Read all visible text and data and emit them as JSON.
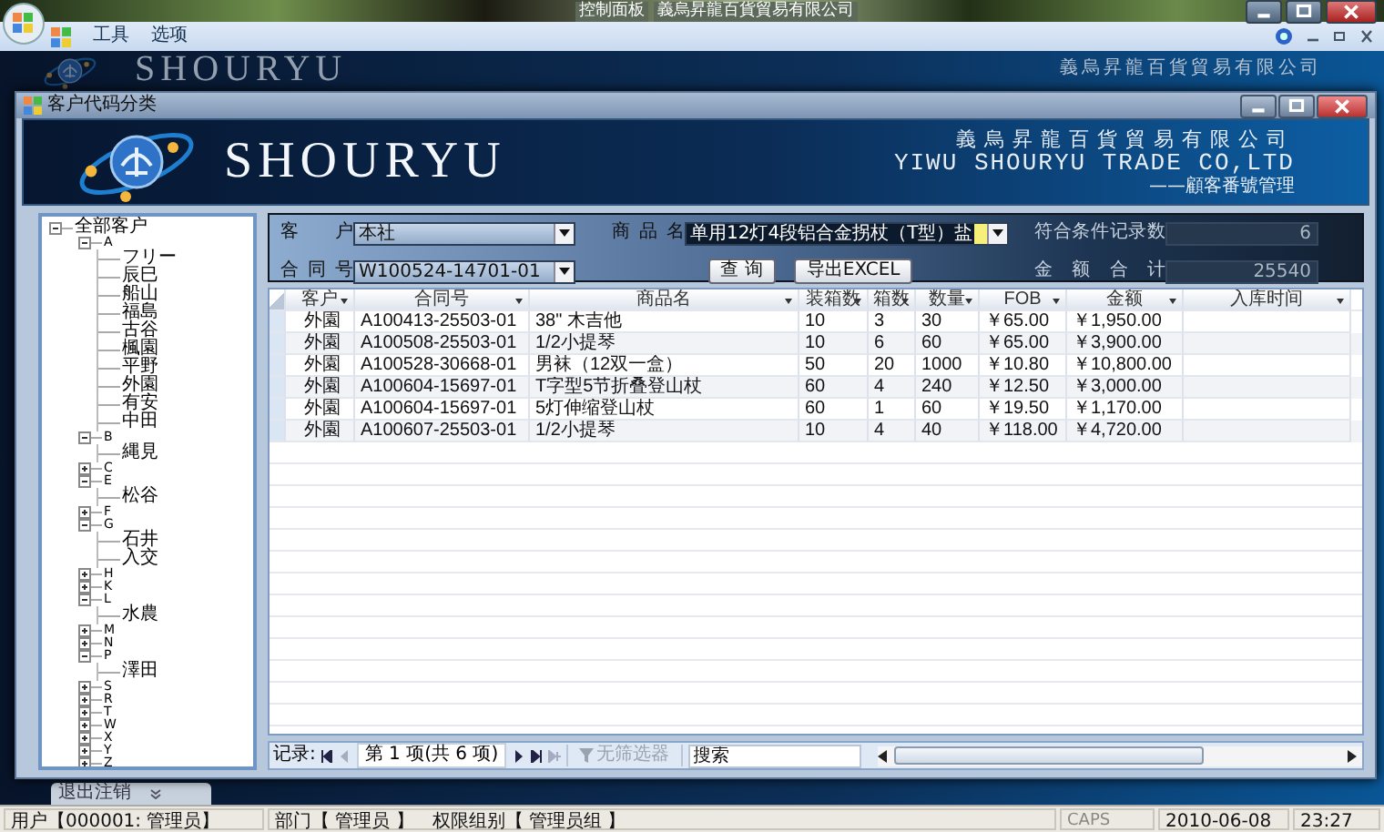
{
  "outer_window": {
    "title_parts": [
      "控制面板",
      "義烏昇龍百貨貿易有限公司"
    ]
  },
  "menu": [
    {
      "label": "工具"
    },
    {
      "label": "选项"
    }
  ],
  "background_banner": {
    "logo_text": "SHOURYU",
    "company": "義烏昇龍百貨貿易有限公司"
  },
  "bottom_tab": {
    "label": "退出注销"
  },
  "dialog": {
    "title": "客户代码分类",
    "banner": {
      "logo_text": "SHOURYU",
      "company_cn": "義烏昇龍百貨貿易有限公司",
      "company_en": "YIWU SHOURYU TRADE CO,LTD",
      "subtitle": "——顧客番號管理"
    },
    "tree": {
      "label": "全部客户",
      "expanded": true,
      "children": [
        {
          "label": "A",
          "expanded": true,
          "children": [
            {
              "label": "フリー"
            },
            {
              "label": "辰巳"
            },
            {
              "label": "船山"
            },
            {
              "label": "福島"
            },
            {
              "label": "古谷"
            },
            {
              "label": "楓園"
            },
            {
              "label": "平野"
            },
            {
              "label": "外園"
            },
            {
              "label": "有安"
            },
            {
              "label": "中田"
            }
          ]
        },
        {
          "label": "B",
          "expanded": true,
          "children": [
            {
              "label": "縄見"
            }
          ]
        },
        {
          "label": "C",
          "expanded": false
        },
        {
          "label": "E",
          "expanded": true,
          "children": [
            {
              "label": "松谷"
            }
          ]
        },
        {
          "label": "F",
          "expanded": false
        },
        {
          "label": "G",
          "expanded": true,
          "children": [
            {
              "label": "石井"
            },
            {
              "label": "入交"
            }
          ]
        },
        {
          "label": "H",
          "expanded": false
        },
        {
          "label": "K",
          "expanded": false
        },
        {
          "label": "L",
          "expanded": true,
          "children": [
            {
              "label": "水農"
            }
          ]
        },
        {
          "label": "M",
          "expanded": false
        },
        {
          "label": "N",
          "expanded": false
        },
        {
          "label": "P",
          "expanded": true,
          "children": [
            {
              "label": "澤田"
            }
          ]
        },
        {
          "label": "S",
          "expanded": false
        },
        {
          "label": "R",
          "expanded": false
        },
        {
          "label": "T",
          "expanded": false
        },
        {
          "label": "W",
          "expanded": false
        },
        {
          "label": "X",
          "expanded": false
        },
        {
          "label": "Y",
          "expanded": false
        },
        {
          "label": "Z",
          "expanded": false
        }
      ]
    },
    "filters": {
      "customer": {
        "label": "客户",
        "value": "本社"
      },
      "contract": {
        "label": "合同号",
        "value": "W100524-14701-01"
      },
      "product": {
        "label": "商品名",
        "value": "单用12灯4段铝合金拐杖（T型）盐"
      },
      "record_count": {
        "label": "符合条件记录数",
        "value": "6"
      },
      "amount_total": {
        "label": "金额合计",
        "value": "25540"
      },
      "buttons": [
        "查 询",
        "导出EXCEL"
      ]
    },
    "table": {
      "columns": [
        "客户",
        "合同号",
        "商品名",
        "装箱数",
        "箱数",
        "数量",
        "FOB",
        "金额",
        "入库时间"
      ],
      "rows": [
        [
          "外園",
          "A100413-25503-01",
          "38\"  木吉他",
          "10",
          "3",
          "30",
          "￥65.00",
          "￥1,950.00",
          ""
        ],
        [
          "外園",
          "A100508-25503-01",
          "1/2小提琴",
          "10",
          "6",
          "60",
          "￥65.00",
          "￥3,900.00",
          ""
        ],
        [
          "外園",
          "A100528-30668-01",
          "男袜（12双一盒）",
          "50",
          "20",
          "1000",
          "￥10.80",
          "￥10,800.00",
          ""
        ],
        [
          "外園",
          "A100604-15697-01",
          "T字型5节折叠登山杖",
          "60",
          "4",
          "240",
          "￥12.50",
          "￥3,000.00",
          ""
        ],
        [
          "外園",
          "A100604-15697-01",
          "5灯伸缩登山杖",
          "60",
          "1",
          "60",
          "￥19.50",
          "￥1,170.00",
          ""
        ],
        [
          "外園",
          "A100607-25503-01",
          "1/2小提琴",
          "10",
          "4",
          "40",
          "￥118.00",
          "￥4,720.00",
          ""
        ]
      ]
    },
    "navigator": {
      "label": "记录:",
      "position": "第 1 项(共 6 项)",
      "filter": {
        "label": "无筛选器",
        "disabled": true
      },
      "search": {
        "placeholder": "搜索"
      }
    }
  },
  "status_bar": {
    "user": "用户【000001: 管理员】",
    "dept": "部门【 管理员 】",
    "role": "权限组别【 管理员组 】",
    "caps": "CAPS",
    "date": "2010-06-08",
    "time": "23:27"
  }
}
